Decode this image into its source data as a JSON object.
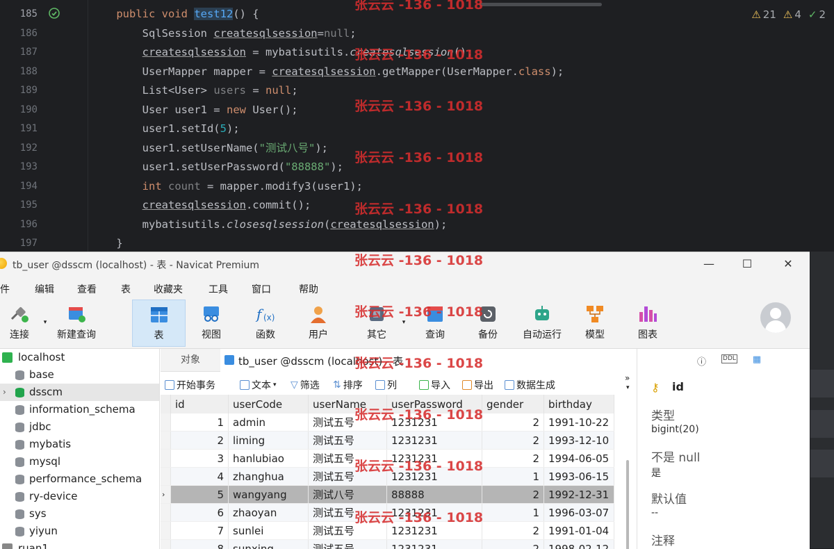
{
  "editor": {
    "line_numbers": [
      "185",
      "186",
      "187",
      "188",
      "189",
      "190",
      "191",
      "192",
      "193",
      "194",
      "195",
      "196",
      "197"
    ],
    "inspections": {
      "warnings": "21",
      "weak_warnings": "4",
      "ok": "2"
    },
    "code": {
      "l185": {
        "a": "public void ",
        "b": "test12",
        "c": "() {"
      },
      "l186": {
        "a": "SqlSession ",
        "b": "createsqlsession",
        "c": "=",
        "d": "null",
        "e": ";"
      },
      "l187": {
        "a": "createsqlsession",
        "b": " = mybatisutils.",
        "c": "createsqlsession",
        "d": "();"
      },
      "l188": {
        "a": "UserMapper mapper = ",
        "b": "createsqlsession",
        "c": ".getMapper(UserMapper.",
        "d": "class",
        "e": ");"
      },
      "l189": {
        "a": "List<User> ",
        "b": "users",
        "c": " = ",
        "d": "null",
        "e": ";"
      },
      "l190": {
        "a": "User user1 = ",
        "b": "new",
        "c": " User();"
      },
      "l191": {
        "a": "user1.setId(",
        "b": "5",
        "c": ");"
      },
      "l192": {
        "a": "user1.setUserName(",
        "b": "\"测试八号\"",
        "c": ");"
      },
      "l193": {
        "a": "user1.setUserPassword(",
        "b": "\"88888\"",
        "c": ");"
      },
      "l194": {
        "a": "int",
        "b": " count",
        "c": " = mapper.modify3(user1);"
      },
      "l195": {
        "a": "createsqlsession",
        "b": ".commit();"
      },
      "l196": {
        "a": "mybatisutils.",
        "b": "closesqlsession",
        "c": "(",
        "d": "createsqlsession",
        "e": ");"
      },
      "l197": {
        "a": "}"
      }
    }
  },
  "watermark": "张云云 -136 - 1018",
  "navicat": {
    "title": "tb_user @dsscm (localhost) - 表 - Navicat Premium",
    "window_buttons": {
      "minimize": "—",
      "maximize": "☐",
      "close": "✕"
    },
    "menu": [
      "文件",
      "编辑",
      "查看",
      "表",
      "收藏夹",
      "工具",
      "窗口",
      "帮助"
    ],
    "toolbar": [
      "连接",
      "新建查询",
      "表",
      "视图",
      "函数",
      "用户",
      "其它",
      "查询",
      "备份",
      "自动运行",
      "模型",
      "图表"
    ],
    "tree": {
      "connection": "localhost",
      "databases": [
        "base",
        "dsscm",
        "information_schema",
        "jdbc",
        "mybatis",
        "mysql",
        "performance_schema",
        "ry-device",
        "sys",
        "yiyun"
      ],
      "next_connection": "ruan1"
    },
    "tabs": {
      "objects": "对象",
      "table": "tb_user @dsscm (localhost) - 表"
    },
    "subtoolbar": [
      "开始事务",
      "文本",
      "筛选",
      "排序",
      "列",
      "导入",
      "导出",
      "数据生成"
    ],
    "grid": {
      "columns": [
        "id",
        "userCode",
        "userName",
        "userPassword",
        "gender",
        "birthday"
      ],
      "rows": [
        [
          "1",
          "admin",
          "测试五号",
          "1231231",
          "2",
          "1991-10-22"
        ],
        [
          "2",
          "liming",
          "测试五号",
          "1231231",
          "2",
          "1993-12-10"
        ],
        [
          "3",
          "hanlubiao",
          "测试五号",
          "1231231",
          "2",
          "1994-06-05"
        ],
        [
          "4",
          "zhanghua",
          "测试五号",
          "1231231",
          "1",
          "1993-06-15"
        ],
        [
          "5",
          "wangyang",
          "测试八号",
          "88888",
          "2",
          "1992-12-31"
        ],
        [
          "6",
          "zhaoyan",
          "测试五号",
          "1231231",
          "1",
          "1996-03-07"
        ],
        [
          "7",
          "sunlei",
          "测试五号",
          "1231231",
          "2",
          "1991-01-04"
        ],
        [
          "8",
          "sunxing",
          "测试五号",
          "1231231",
          "2",
          "1998-02-12"
        ]
      ]
    },
    "properties": {
      "field_name": "id",
      "type_label": "类型",
      "type_value": "bigint(20)",
      "notnull_label": "不是 null",
      "notnull_value": "是",
      "default_label": "默认值",
      "default_value": "--",
      "comment_label": "注释"
    }
  }
}
